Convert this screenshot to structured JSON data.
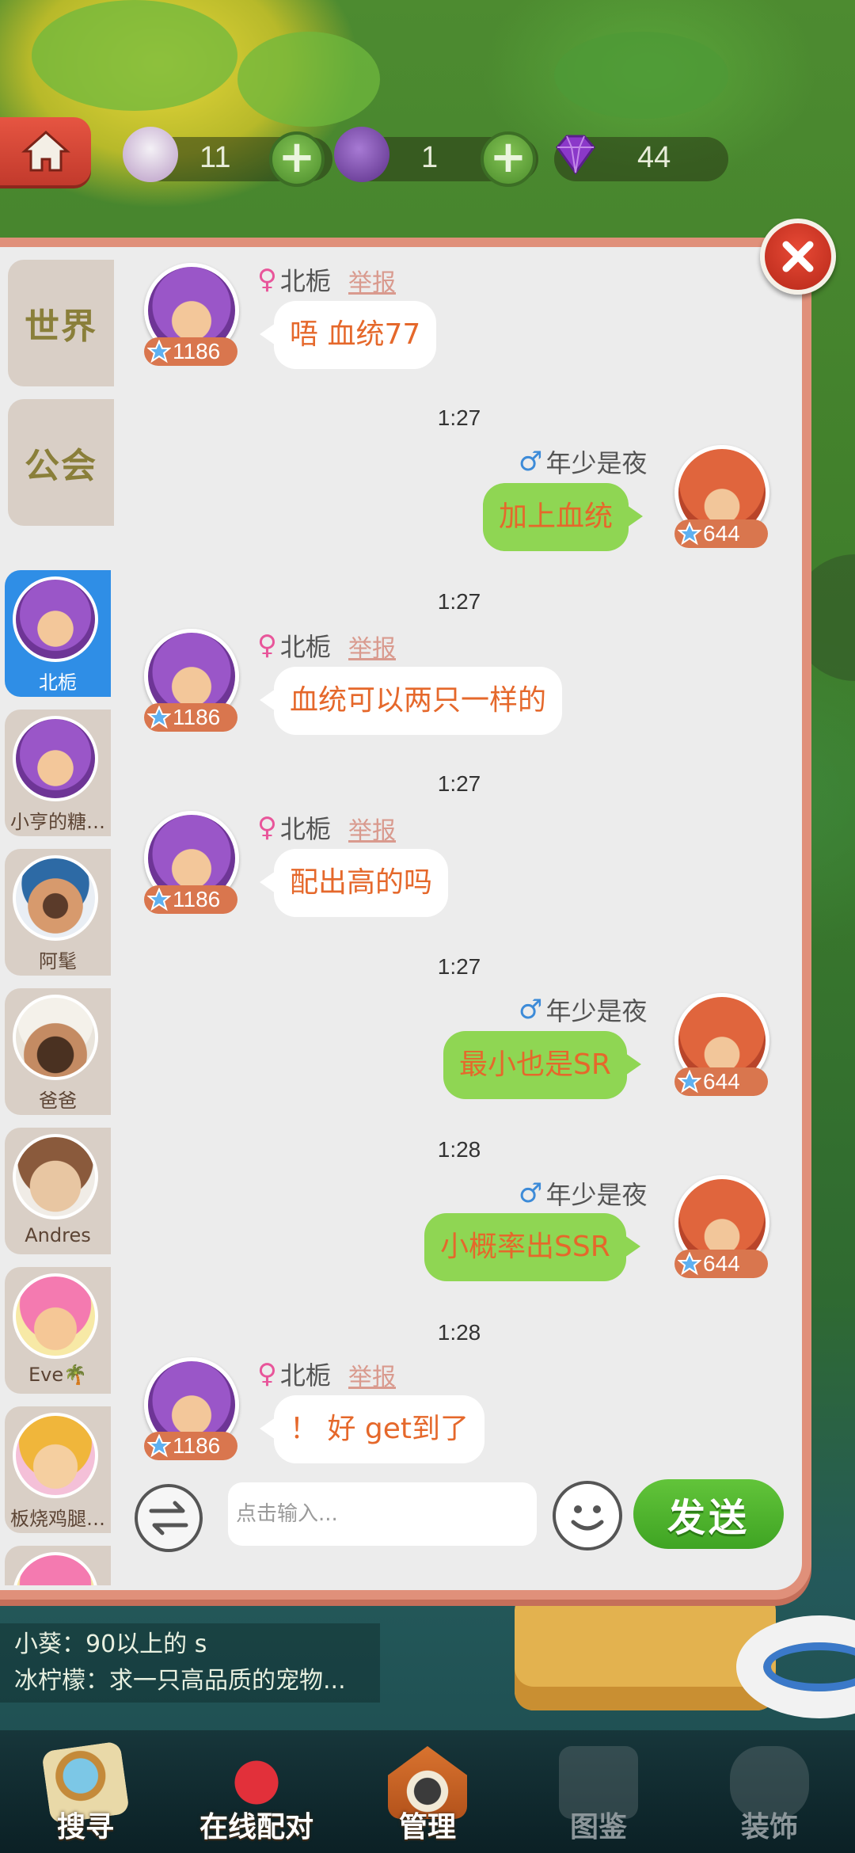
{
  "topbar": {
    "resources": [
      {
        "icon": "milk-bottle-icon",
        "value": "11"
      },
      {
        "icon": "hairdryer-icon",
        "value": "1"
      },
      {
        "icon": "gem-icon",
        "value": "44"
      }
    ]
  },
  "sidebar": {
    "tabs": [
      {
        "label": "世界"
      },
      {
        "label": "公会"
      }
    ],
    "contacts": [
      {
        "name": "北栀",
        "avatar": "purple-hood-avatar",
        "active": true
      },
      {
        "name": "小亨的糖…",
        "avatar": "purple-hood-avatar",
        "active": false
      },
      {
        "name": "阿髦",
        "avatar": "cap-avatar",
        "active": false
      },
      {
        "name": "爸爸",
        "avatar": "bearded-avatar",
        "active": false
      },
      {
        "name": "Andres",
        "avatar": "old-man-avatar",
        "active": false
      },
      {
        "name": "Eve🌴",
        "avatar": "pink-hair-avatar",
        "active": false
      },
      {
        "name": "板烧鸡腿…",
        "avatar": "blonde-avatar",
        "active": false
      }
    ]
  },
  "chat": {
    "report_label": "举报",
    "messages": [
      {
        "side": "left",
        "sender": "北栀",
        "gender": "♀",
        "level": "1186",
        "text": "唔 血统77"
      },
      {
        "time": "1:27"
      },
      {
        "side": "right",
        "sender": "年少是夜",
        "gender": "♂",
        "level": "644",
        "text": "加上血统"
      },
      {
        "time": "1:27"
      },
      {
        "side": "left",
        "sender": "北栀",
        "gender": "♀",
        "level": "1186",
        "text": "血统可以两只一样的"
      },
      {
        "time": "1:27"
      },
      {
        "side": "left",
        "sender": "北栀",
        "gender": "♀",
        "level": "1186",
        "text": "配出高的吗"
      },
      {
        "time": "1:27"
      },
      {
        "side": "right",
        "sender": "年少是夜",
        "gender": "♂",
        "level": "644",
        "text": "最小也是SR"
      },
      {
        "time": "1:28"
      },
      {
        "side": "right",
        "sender": "年少是夜",
        "gender": "♂",
        "level": "644",
        "text": "小概率出SSR"
      },
      {
        "time": "1:28"
      },
      {
        "side": "left",
        "sender": "北栀",
        "gender": "♀",
        "level": "1186",
        "text": "！ 好 get到了"
      }
    ]
  },
  "input": {
    "placeholder": "点击输入...",
    "send_label": "发送"
  },
  "world_preview": [
    "小葵：90以上的 s",
    "冰柠檬：求一只高品质的宠物..."
  ],
  "bottom_nav": [
    {
      "label": "搜寻",
      "icon": "magnifier-icon"
    },
    {
      "label": "在线配对",
      "icon": "heart-arrow-icon"
    },
    {
      "label": "管理",
      "icon": "house-icon"
    },
    {
      "label": "图鉴",
      "icon": "book-icon"
    },
    {
      "label": "装饰",
      "icon": "brush-icon"
    }
  ],
  "colors": {
    "panel_border": "#e0907a",
    "bubble_left": "#ffffff",
    "bubble_right": "#8fd653",
    "message_text": "#e5682b",
    "active_contact": "#2f8ee6",
    "send_button": "#4fb42c"
  }
}
